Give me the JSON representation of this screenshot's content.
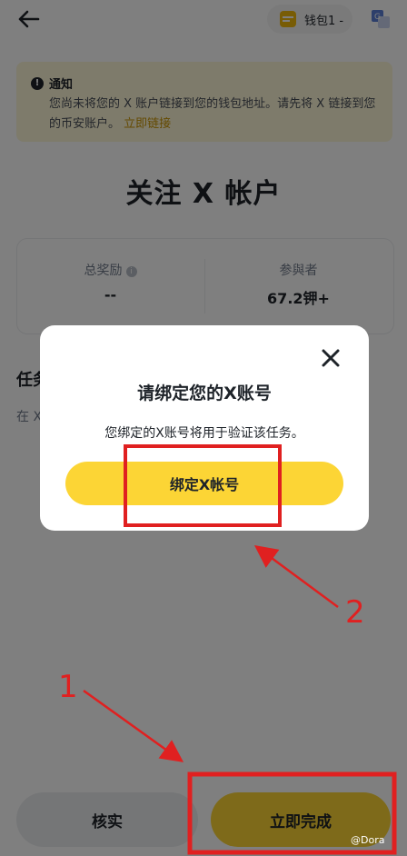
{
  "header": {
    "wallet_label": "钱包1 -"
  },
  "notice": {
    "title": "通知",
    "body": "您尚未将您的 X 账户链接到您的钱包地址。请先将 X 链接到您的币安账户。",
    "link": "立即链接"
  },
  "page_title": "关注 X 帐户",
  "stats": {
    "reward_label": "总奖励",
    "reward_value": "--",
    "participants_label": "参與者",
    "participants_value": "67.2钾+"
  },
  "task": {
    "title": "任务",
    "subtitle": "在 X"
  },
  "footer": {
    "verify_label": "核实",
    "complete_label": "立即完成"
  },
  "modal": {
    "title": "请绑定您的X账号",
    "description": "您绑定的X账号将用于验证该任务。",
    "button_label": "绑定X帐号"
  },
  "annotations": {
    "one": "1",
    "two": "2",
    "watermark": "@Dora",
    "color": "#e02020"
  },
  "colors": {
    "brand_yellow": "#fcd535",
    "notice_bg": "#fdf6d6",
    "link": "#c99400"
  }
}
